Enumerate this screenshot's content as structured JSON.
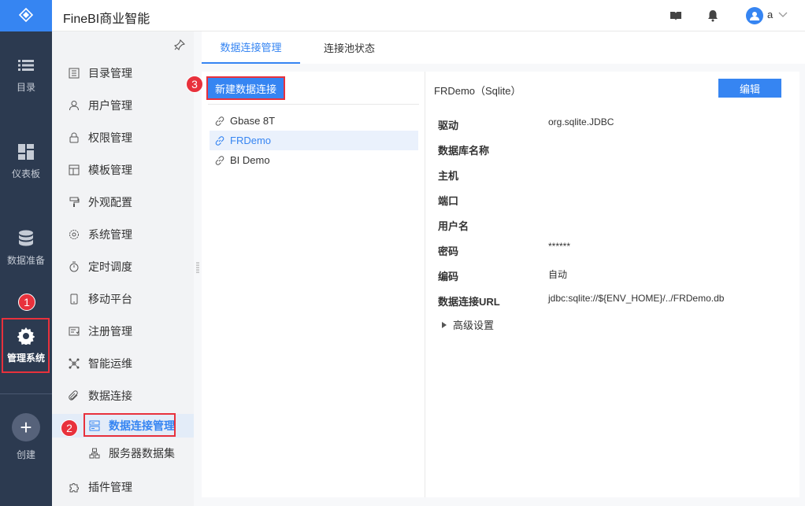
{
  "app": {
    "title": "FineBI商业智能",
    "user": "a"
  },
  "rail": {
    "items": [
      {
        "label": "目录",
        "icon": "list-icon"
      },
      {
        "label": "仪表板",
        "icon": "dashboard-icon"
      },
      {
        "label": "数据准备",
        "icon": "database-icon"
      },
      {
        "label": "管理系统",
        "icon": "gear-icon"
      },
      {
        "label": "创建",
        "icon": "plus-icon"
      }
    ]
  },
  "sidebar": {
    "items": [
      {
        "label": "目录管理",
        "icon": "catalog-icon"
      },
      {
        "label": "用户管理",
        "icon": "user-icon"
      },
      {
        "label": "权限管理",
        "icon": "lock-icon"
      },
      {
        "label": "模板管理",
        "icon": "template-icon"
      },
      {
        "label": "外观配置",
        "icon": "brush-icon"
      },
      {
        "label": "系统管理",
        "icon": "settings-icon"
      },
      {
        "label": "定时调度",
        "icon": "timer-icon"
      },
      {
        "label": "移动平台",
        "icon": "mobile-icon"
      },
      {
        "label": "注册管理",
        "icon": "register-icon"
      },
      {
        "label": "智能运维",
        "icon": "ops-icon"
      },
      {
        "label": "数据连接",
        "icon": "paperclip-icon"
      },
      {
        "label": "数据连接管理",
        "icon": "connection-manage-icon"
      },
      {
        "label": "服务器数据集",
        "icon": "server-dataset-icon"
      },
      {
        "label": "插件管理",
        "icon": "plugin-icon"
      }
    ]
  },
  "tabs": [
    {
      "label": "数据连接管理"
    },
    {
      "label": "连接池状态"
    }
  ],
  "list": {
    "new_button": "新建数据连接",
    "items": [
      {
        "label": "Gbase 8T"
      },
      {
        "label": "FRDemo"
      },
      {
        "label": "BI Demo"
      }
    ]
  },
  "detail": {
    "title": "FRDemo（Sqlite）",
    "edit_button": "编辑",
    "fields": [
      {
        "label": "驱动",
        "value": "org.sqlite.JDBC"
      },
      {
        "label": "数据库名称",
        "value": ""
      },
      {
        "label": "主机",
        "value": ""
      },
      {
        "label": "端口",
        "value": ""
      },
      {
        "label": "用户名",
        "value": ""
      },
      {
        "label": "密码",
        "value": "******"
      },
      {
        "label": "编码",
        "value": "自动"
      },
      {
        "label": "数据连接URL",
        "value": "jdbc:sqlite://${ENV_HOME}/../FRDemo.db"
      }
    ],
    "advanced": "高级设置"
  },
  "annotations": {
    "step1": "1",
    "step2": "2",
    "step3": "3"
  },
  "colors": {
    "accent": "#3685f2",
    "rail": "#2c3a50",
    "highlight": "#e8313c"
  }
}
